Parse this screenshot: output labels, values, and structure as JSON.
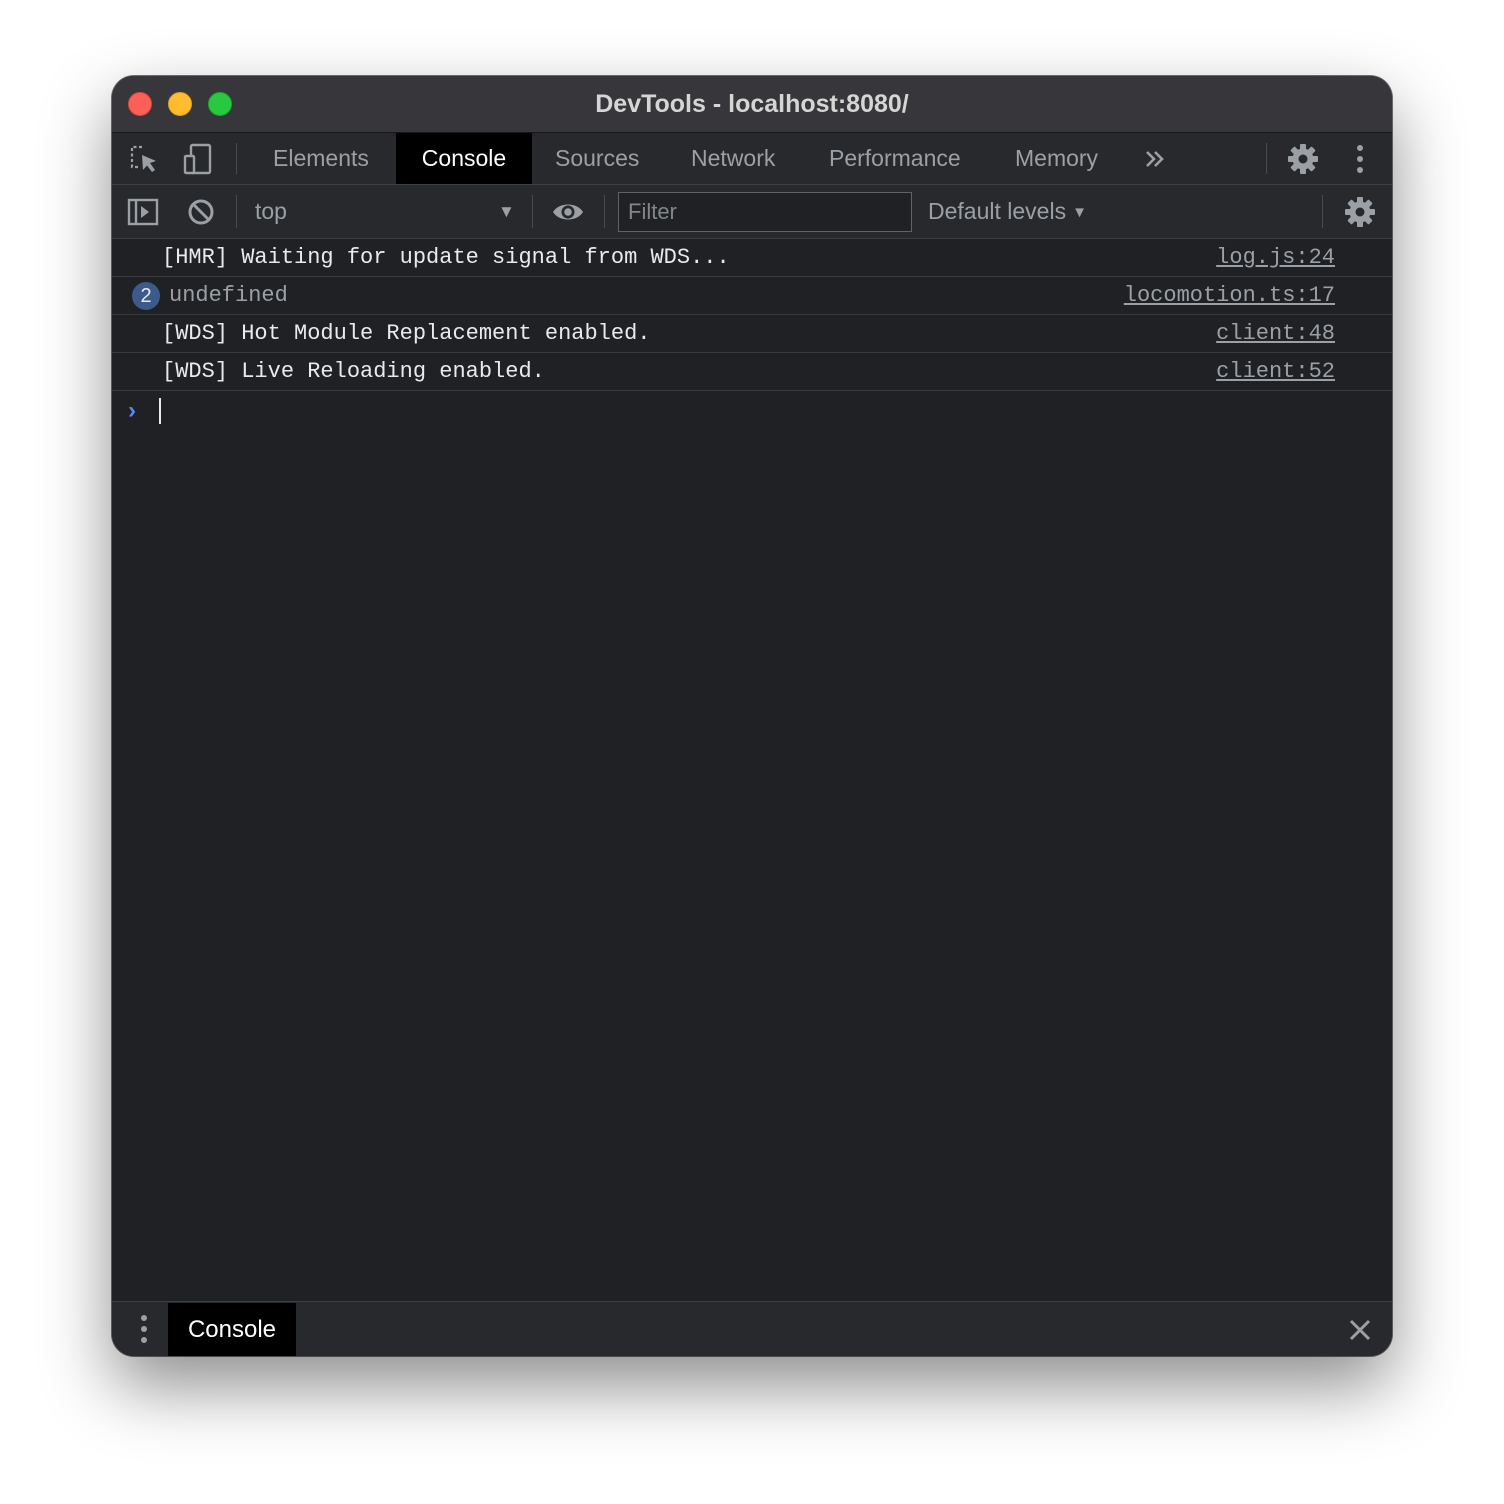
{
  "window": {
    "title": "DevTools - localhost:8080/"
  },
  "tabs": [
    {
      "label": "Elements",
      "active": false
    },
    {
      "label": "Console",
      "active": true
    },
    {
      "label": "Sources",
      "active": false
    },
    {
      "label": "Network",
      "active": false
    },
    {
      "label": "Performance",
      "active": false
    },
    {
      "label": "Memory",
      "active": false
    }
  ],
  "toolbar": {
    "context": "top",
    "filter_placeholder": "Filter",
    "filter_value": "",
    "levels": "Default levels"
  },
  "logs": [
    {
      "message": "[HMR] Waiting for update signal from WDS...",
      "source": "log.js:24"
    },
    {
      "message": "undefined",
      "source": "locomotion.ts:17",
      "count": "2"
    },
    {
      "message": "[WDS] Hot Module Replacement enabled.",
      "source": "client:48"
    },
    {
      "message": "[WDS] Live Reloading enabled.",
      "source": "client:52"
    }
  ],
  "drawer": {
    "tab": "Console"
  },
  "icons": {
    "inspect": "inspect-element-icon",
    "device": "device-toolbar-icon",
    "more_tabs": "chevron-double-right-icon",
    "settings": "gear-icon",
    "menu": "vertical-ellipsis-icon",
    "sidebar": "sidebar-toggle-icon",
    "clear": "clear-console-icon",
    "live_expression": "eye-icon",
    "close": "close-icon"
  },
  "colors": {
    "background": "#202124",
    "toolbar": "#28292c",
    "titlebar": "#36363b",
    "active_tab": "#000000",
    "prompt": "#4c8df6",
    "badge": "#3c5a8c",
    "traffic_close": "#fe5f57",
    "traffic_minimize": "#febc2e",
    "traffic_maximize": "#28c840"
  }
}
